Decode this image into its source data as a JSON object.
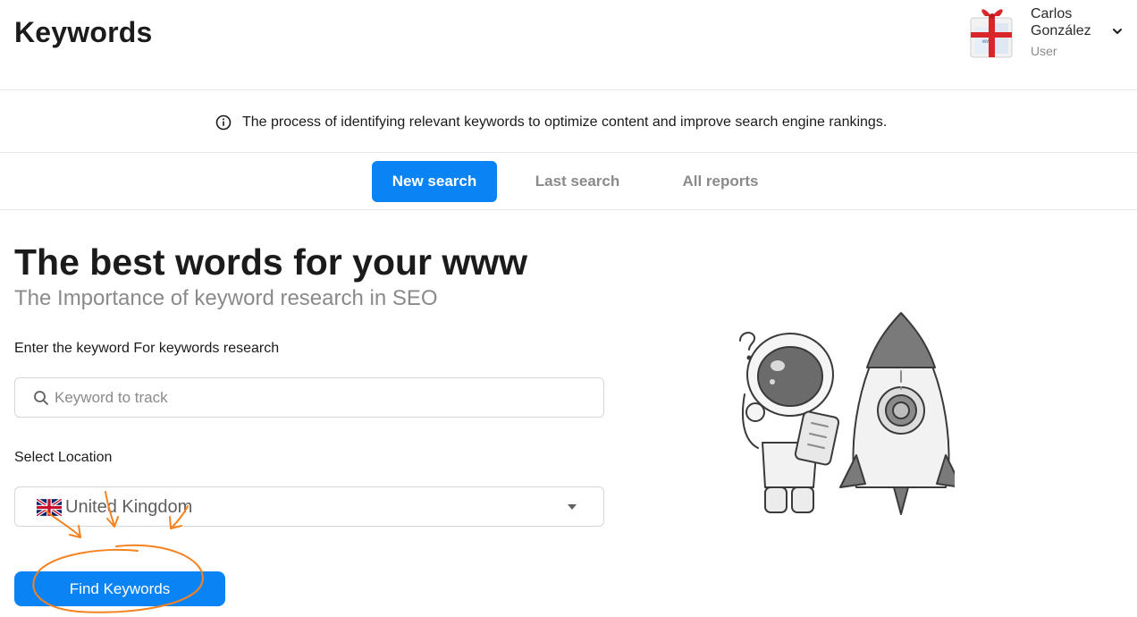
{
  "header": {
    "title": "Keywords",
    "user": {
      "name": "Carlos González",
      "role": "User"
    }
  },
  "info": {
    "icon": "info-icon",
    "text": "The process of identifying relevant keywords to optimize content and improve search engine rankings."
  },
  "tabs": [
    {
      "label": "New search",
      "active": true
    },
    {
      "label": "Last search",
      "active": false
    },
    {
      "label": "All reports",
      "active": false
    }
  ],
  "main": {
    "heading": "The best words for your www",
    "subheading": "The Importance of keyword research in SEO",
    "keyword_label": "Enter the keyword For keywords research",
    "keyword_placeholder": "Keyword to track",
    "keyword_value": "",
    "location_label": "Select Location",
    "location_value": "United Kingdom",
    "location_flag": "uk-flag-icon",
    "submit_label": "Find Keywords"
  },
  "colors": {
    "accent": "#0a84f5",
    "annotation": "#f58220",
    "muted_text": "#8a8a8a"
  }
}
